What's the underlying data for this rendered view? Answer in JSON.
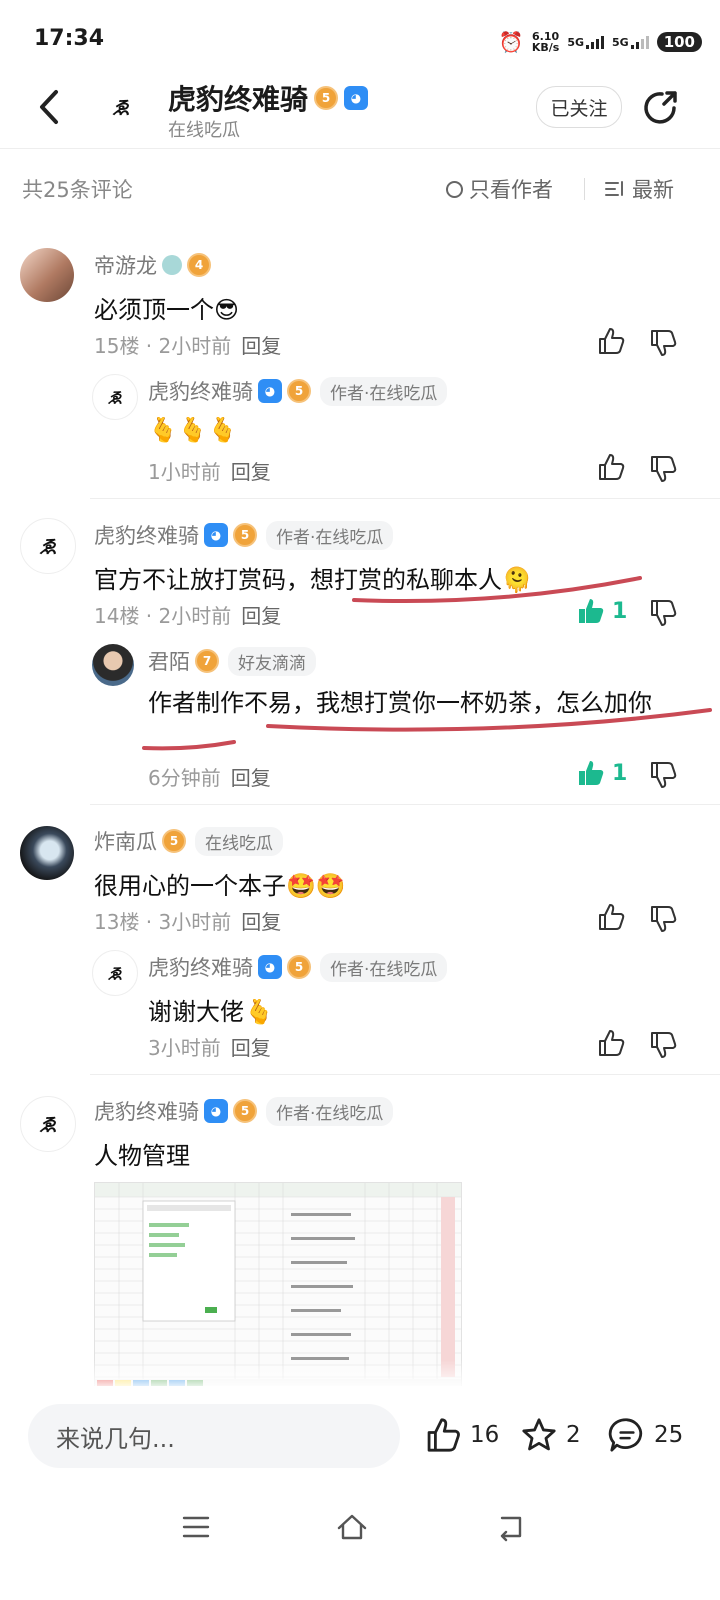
{
  "status_bar": {
    "time": "17:34",
    "net_speed": "6.10",
    "net_unit": "KB/s",
    "sim1": "5G",
    "sim2": "5G",
    "battery": "100"
  },
  "header": {
    "author_name": "虎豹终难骑",
    "level_badge": "5",
    "subtitle": "在线吃瓜",
    "follow_label": "已关注"
  },
  "filter_bar": {
    "count": "共25条评论",
    "author_only": "只看作者",
    "sort": "最新"
  },
  "comments": [
    {
      "user": "帝游龙",
      "level": "4",
      "text": "必须顶一个😎",
      "floor": "15楼 · 2小时前",
      "reply_label": "回复",
      "replies": [
        {
          "user": "虎豹终难骑",
          "level": "5",
          "tag": "作者·在线吃瓜",
          "text": "🫰🫰🫰",
          "time": "1小时前",
          "reply_label": "回复"
        }
      ]
    },
    {
      "user": "虎豹终难骑",
      "level": "5",
      "tag": "作者·在线吃瓜",
      "text": "官方不让放打赏码，想打赏的私聊本人🫠",
      "floor": "14楼 · 2小时前",
      "reply_label": "回复",
      "likes": "1",
      "replies": [
        {
          "user": "君陌",
          "level": "7",
          "tag": "好友滴滴",
          "text": "作者制作不易，我想打赏你一杯奶茶，怎么加你",
          "time": "6分钟前",
          "reply_label": "回复",
          "likes": "1"
        }
      ]
    },
    {
      "user": "炸南瓜",
      "level": "5",
      "tag": "在线吃瓜",
      "text": "很用心的一个本子🤩🤩",
      "floor": "13楼 · 3小时前",
      "reply_label": "回复",
      "replies": [
        {
          "user": "虎豹终难骑",
          "level": "5",
          "tag": "作者·在线吃瓜",
          "text": "谢谢大佬🫰",
          "time": "3小时前",
          "reply_label": "回复"
        }
      ]
    },
    {
      "user": "虎豹终难骑",
      "level": "5",
      "tag": "作者·在线吃瓜",
      "text": "人物管理"
    }
  ],
  "bottom_bar": {
    "input_placeholder": "来说几句...",
    "likes": "16",
    "favorites": "2",
    "comments": "25"
  },
  "colors": {
    "accent_green": "#1cb98f",
    "annotation_red": "#c94a55",
    "level_badge": "#f0a33a",
    "game_badge": "#2f8ef5"
  }
}
